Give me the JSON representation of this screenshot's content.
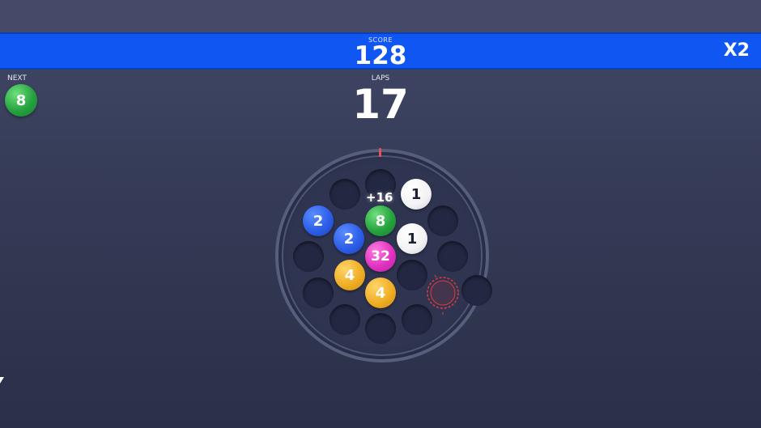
{
  "hud": {
    "score_label": "SCORE",
    "score": "128",
    "multiplier": "X2",
    "next_label": "NEXT",
    "next_ball": "8",
    "laps_label": "LAPS",
    "laps": "17"
  },
  "board": {
    "popup": "+16",
    "balls": [
      {
        "value": "1",
        "color": "white"
      },
      {
        "value": "2",
        "color": "blue"
      },
      {
        "value": "8",
        "color": "green"
      },
      {
        "value": "2",
        "color": "blue"
      },
      {
        "value": "1",
        "color": "white"
      },
      {
        "value": "32",
        "color": "pink"
      },
      {
        "value": "4",
        "color": "yellow"
      },
      {
        "value": "4",
        "color": "yellow"
      }
    ]
  },
  "colors": {
    "score_bar": "#0f56f2",
    "background": "#353b56",
    "slot": "#232842",
    "target": "#e23a3a",
    "ball_blue": "#2c5ee8",
    "ball_green": "#25a33f",
    "ball_pink": "#e133c1",
    "ball_yellow": "#f0ae25",
    "ball_white": "#f2f2f4"
  }
}
